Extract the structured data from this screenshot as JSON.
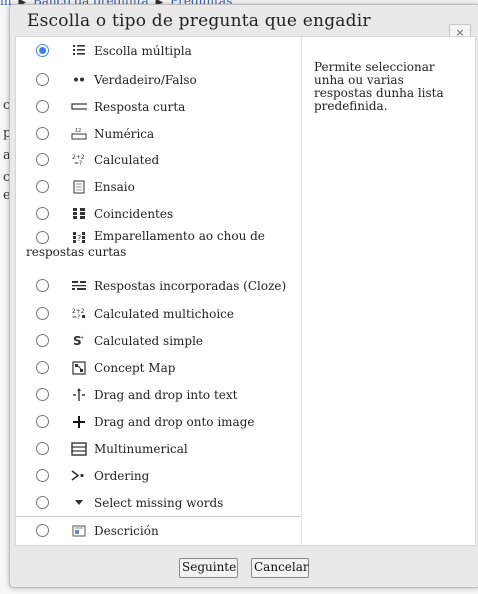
{
  "background": {
    "breadcrumb": [
      "in",
      "Banco da pregunta",
      "Preguntas"
    ],
    "letters": [
      "c",
      "p",
      "a",
      "c",
      "e"
    ]
  },
  "dialog": {
    "title": "Escolla o tipo de pregunta que engadir",
    "close_label": "×",
    "description": "Permite seleccionar unha ou varias respostas dunha lista predefinida.",
    "options": [
      {
        "label": "Escolla múltipla",
        "icon": "multichoice-icon",
        "selected": true
      },
      {
        "label": "Verdadeiro/Falso",
        "icon": "truefalse-icon",
        "selected": false
      },
      {
        "label": "Resposta curta",
        "icon": "shortanswer-icon",
        "selected": false
      },
      {
        "label": "Numérica",
        "icon": "numerical-icon",
        "selected": false
      },
      {
        "label": "Calculated",
        "icon": "calculated-icon",
        "selected": false
      },
      {
        "label": "Ensaio",
        "icon": "essay-icon",
        "selected": false
      },
      {
        "label": "Coincidentes",
        "icon": "match-icon",
        "selected": false
      },
      {
        "label": "Emparellamento ao chou de",
        "label2": "respostas curtas",
        "icon": "randomsamatch-icon",
        "selected": false
      },
      {
        "label": "Respostas incorporadas (Cloze)",
        "icon": "cloze-icon",
        "selected": false
      },
      {
        "label": "Calculated multichoice",
        "icon": "calculatedmulti-icon",
        "selected": false
      },
      {
        "label": "Calculated simple",
        "icon": "calculatedsimple-icon",
        "selected": false
      },
      {
        "label": "Concept Map",
        "icon": "conceptmap-icon",
        "selected": false
      },
      {
        "label": "Drag and drop into text",
        "icon": "ddwtos-icon",
        "selected": false
      },
      {
        "label": "Drag and drop onto image",
        "icon": "ddimage-icon",
        "selected": false
      },
      {
        "label": "Multinumerical",
        "icon": "multinumerical-icon",
        "selected": false
      },
      {
        "label": "Ordering",
        "icon": "ordering-icon",
        "selected": false
      },
      {
        "label": "Select missing words",
        "icon": "gapselect-icon",
        "selected": false
      },
      {
        "label": "Descrición",
        "icon": "description-icon",
        "selected": false
      }
    ],
    "buttons": {
      "next": "Seguinte",
      "cancel": "Cancelar"
    }
  }
}
